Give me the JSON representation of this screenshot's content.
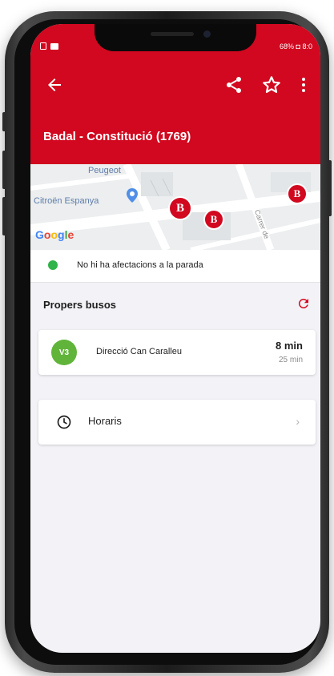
{
  "status_bar": {
    "right_text": "68% ◘ 8:0"
  },
  "header": {
    "stop_title": "Badal - Constitució (1769)",
    "color": "#d1081f"
  },
  "map": {
    "labels": {
      "peugeot": "Peugeot",
      "citroen": "Citroën Espanya",
      "street": "Carrer de"
    },
    "bus_stop_marker": "B",
    "google_logo": {
      "G": "G",
      "o1": "o",
      "o2": "o",
      "g": "g",
      "l": "l",
      "e": "e"
    }
  },
  "alert": {
    "text": "No hi ha afectacions a la parada",
    "status_color": "#30b34a"
  },
  "next_buses": {
    "title": "Propers busos",
    "items": [
      {
        "line": "V3",
        "line_color": "#61b43a",
        "direction": "Direcció Can Caralleu",
        "eta_first": "8 min",
        "eta_second": "25 min"
      }
    ]
  },
  "schedule": {
    "label": "Horaris"
  },
  "icons": {
    "back": "arrow-left-icon",
    "share": "share-icon",
    "favorite": "star-outline-icon",
    "more": "more-vert-icon",
    "refresh": "refresh-icon",
    "clock": "clock-icon",
    "chevron": "chevron-right-icon",
    "chevron_glyph": "›"
  }
}
